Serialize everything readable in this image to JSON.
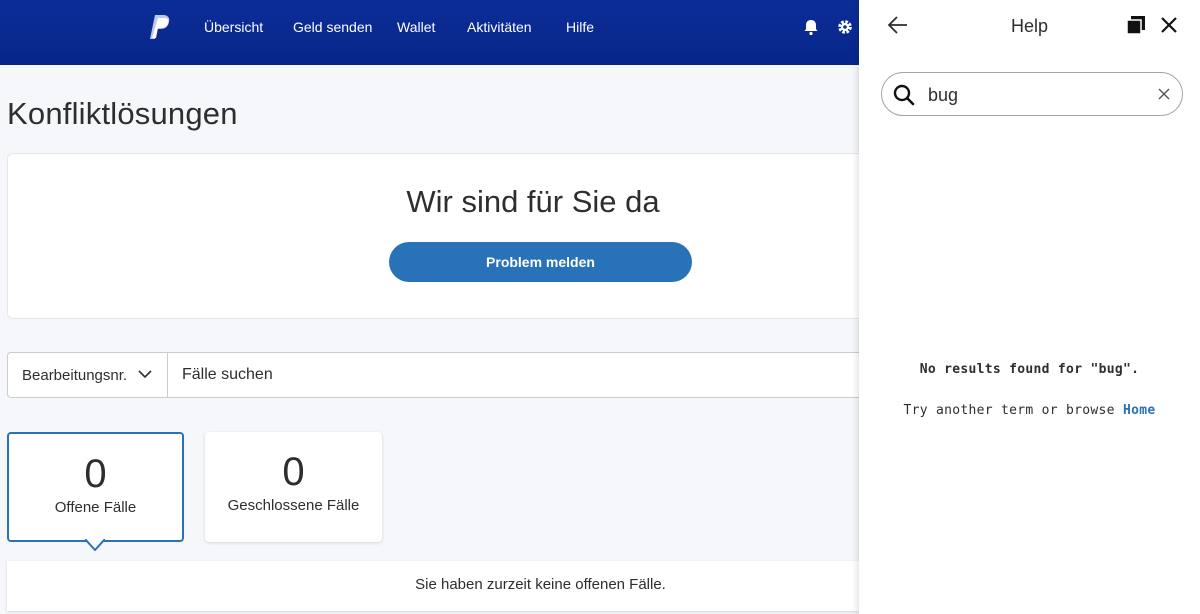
{
  "nav": {
    "logo": "paypal-logo",
    "items": [
      {
        "label": "Übersicht"
      },
      {
        "label": "Geld senden"
      },
      {
        "label": "Wallet"
      },
      {
        "label": "Aktivitäten"
      },
      {
        "label": "Hilfe"
      }
    ]
  },
  "main": {
    "title": "Konfliktlösungen",
    "hero_heading": "Wir sind für Sie da",
    "report_button": "Problem melden",
    "filter_select": "Bearbeitungsnr.",
    "search_placeholder": "Fälle suchen",
    "cards": [
      {
        "count": "0",
        "label": "Offene Fälle"
      },
      {
        "count": "0",
        "label": "Geschlossene Fälle"
      }
    ],
    "notice": "Sie haben zurzeit keine offenen Fälle."
  },
  "help": {
    "title": "Help",
    "search_value": "bug",
    "no_results": "No results found for \"bug\".",
    "try_text": "Try another term or browse",
    "home_link": "Home"
  },
  "colors": {
    "nav_background": "#0b2d97",
    "primary_button": "#2a72b8",
    "link": "#2a72b8"
  }
}
